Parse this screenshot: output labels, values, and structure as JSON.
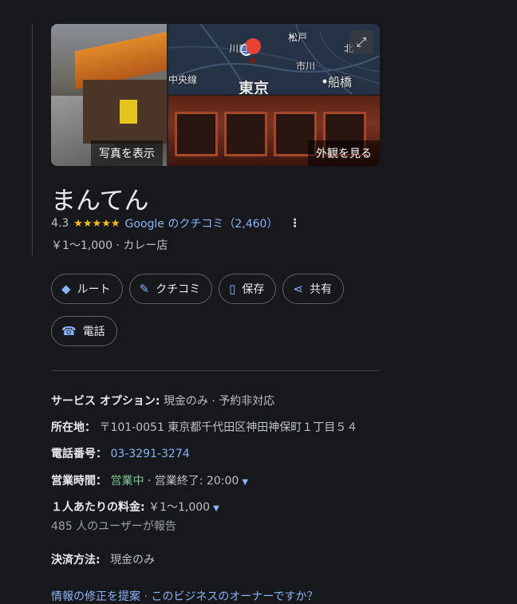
{
  "photos": {
    "left_label": "写真を表示",
    "right_label": "外観を見る",
    "map_labels": [
      "川口",
      "松戸",
      "市川",
      "中央線",
      "東京",
      "船橋",
      "北"
    ]
  },
  "place": {
    "name": "まんてん",
    "rating": "4.3",
    "stars": "★★★★★",
    "reviews_link": "Google のクチコミ（2,460）",
    "price_category": "￥1～1,000 · カレー店"
  },
  "actions": {
    "route": "ルート",
    "review": "クチコミ",
    "save": "保存",
    "share": "共有",
    "call": "電話"
  },
  "info": {
    "service_label": "サービス オプション:",
    "service_value": "現金のみ · 予約非対応",
    "address_label": "所在地：",
    "address_value": "〒101-0051 東京都千代田区神田神保町１丁目５４",
    "phone_label": "電話番号：",
    "phone_value": "03-3291-3274",
    "hours_label": "営業時間：",
    "hours_open": "営業中",
    "hours_close": " · 営業終了: 20:00",
    "price_label": "１人あたりの料金:",
    "price_value": "￥1～1,000",
    "price_sub": "485 人のユーザーが報告",
    "payment_label": "決済方法:",
    "payment_value": "現金のみ"
  },
  "footer": {
    "suggest": "情報の修正を提案",
    "separator": " · ",
    "owner": "このビジネスのオーナーですか？"
  },
  "colors": {
    "background": "#17181c",
    "accent": "#8ab4f8",
    "star": "#fbbc04",
    "open": "#81c995"
  }
}
